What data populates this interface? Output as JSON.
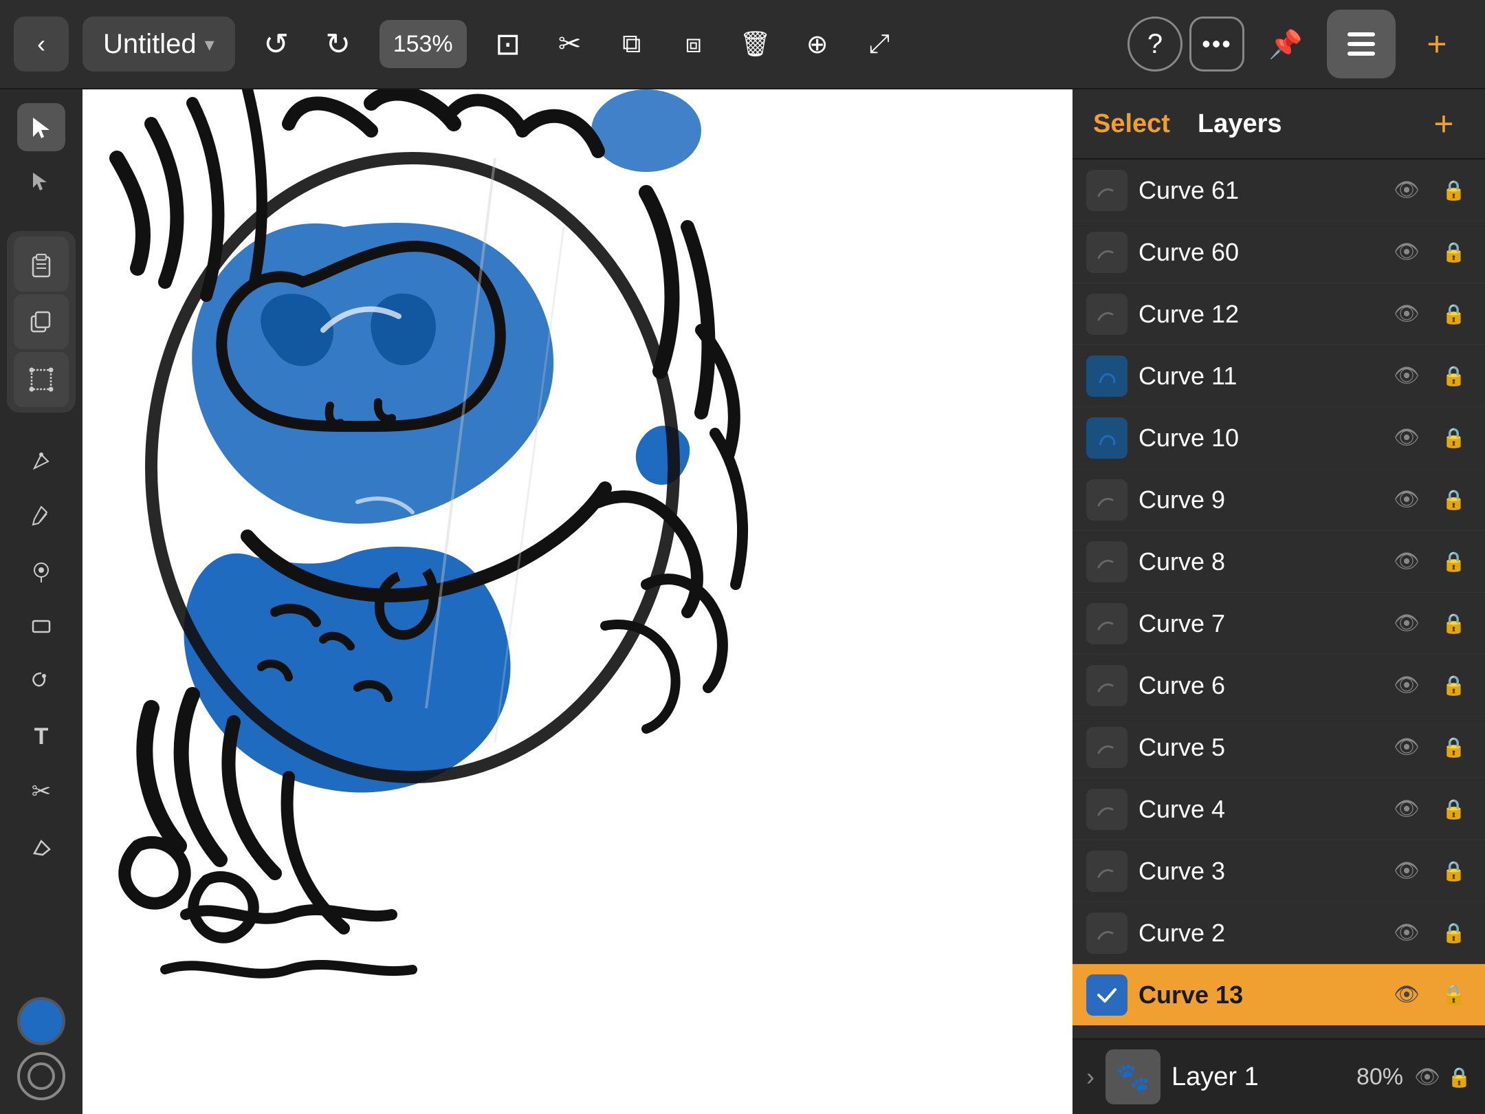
{
  "toolbar": {
    "back_label": "‹",
    "title": "Untitled",
    "title_chevron": "▾",
    "zoom": "153%",
    "undo_label": "↺",
    "redo_label": "↻",
    "select_rect_label": "⊡",
    "cut_label": "✂",
    "copy_label": "⧉",
    "paste_label": "⧈",
    "delete_label": "🗑",
    "duplicate_label": "⊕",
    "transform_label": "⤢",
    "help_label": "?",
    "more_label": "•••",
    "pin_label": "📌",
    "layers_label": "≡",
    "add_label": "+"
  },
  "tools": {
    "select": "▲",
    "direct_select": "◂",
    "pen": "✒",
    "pencil": "△",
    "brush": "○",
    "shape_rect": "□",
    "lasso": "⌀",
    "text": "T",
    "scissors": "✂",
    "eraser": "◈"
  },
  "panel": {
    "select_tab": "Select",
    "layers_tab": "Layers",
    "add_btn": "+"
  },
  "layers": [
    {
      "id": "curve61",
      "name": "Curve 61",
      "thumb_type": "dark",
      "visible": true,
      "locked": true,
      "active": false
    },
    {
      "id": "curve60",
      "name": "Curve 60",
      "thumb_type": "dark",
      "visible": true,
      "locked": true,
      "active": false
    },
    {
      "id": "curve12",
      "name": "Curve 12",
      "thumb_type": "dark",
      "visible": true,
      "locked": true,
      "active": false
    },
    {
      "id": "curve11",
      "name": "Curve 11",
      "thumb_type": "blue_accent",
      "visible": true,
      "locked": true,
      "active": false
    },
    {
      "id": "curve10",
      "name": "Curve 10",
      "thumb_type": "blue_accent",
      "visible": true,
      "locked": true,
      "active": false
    },
    {
      "id": "curve9",
      "name": "Curve 9",
      "thumb_type": "dark",
      "visible": true,
      "locked": true,
      "active": false
    },
    {
      "id": "curve8",
      "name": "Curve 8",
      "thumb_type": "dark",
      "visible": true,
      "locked": true,
      "active": false
    },
    {
      "id": "curve7",
      "name": "Curve 7",
      "thumb_type": "dark",
      "visible": true,
      "locked": true,
      "active": false
    },
    {
      "id": "curve6",
      "name": "Curve 6",
      "thumb_type": "dark",
      "visible": true,
      "locked": true,
      "active": false
    },
    {
      "id": "curve5",
      "name": "Curve 5",
      "thumb_type": "dark",
      "visible": true,
      "locked": true,
      "active": false
    },
    {
      "id": "curve4",
      "name": "Curve 4",
      "thumb_type": "dark",
      "visible": true,
      "locked": true,
      "active": false
    },
    {
      "id": "curve3",
      "name": "Curve 3",
      "thumb_type": "dark",
      "visible": true,
      "locked": true,
      "active": false
    },
    {
      "id": "curve2",
      "name": "Curve 2",
      "thumb_type": "dark",
      "visible": true,
      "locked": true,
      "active": false
    },
    {
      "id": "curve13",
      "name": "Curve 13",
      "thumb_type": "dark",
      "visible": true,
      "locked": true,
      "active": true
    }
  ],
  "layer_group": {
    "name": "Layer 1",
    "opacity": "80%",
    "thumb_emoji": "🐾"
  },
  "canvas": {
    "bg_color": "#ffffff"
  },
  "colors": {
    "primary": "#1e6bbf",
    "accent": "#f0a030",
    "toolbar_bg": "#2d2d2d",
    "panel_bg": "#2d2d2d",
    "layer_active": "#f0a030"
  }
}
